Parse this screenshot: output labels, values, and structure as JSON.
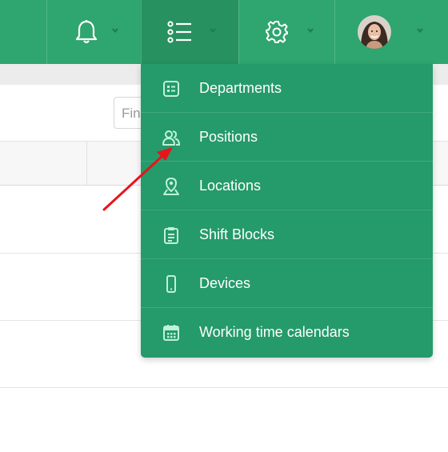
{
  "topbar": {
    "background": "#2fa56f",
    "items": [
      {
        "name": "notifications",
        "icon": "bell-icon"
      },
      {
        "name": "lists",
        "icon": "list-icon",
        "active": true
      },
      {
        "name": "settings",
        "icon": "gear-icon"
      },
      {
        "name": "profile",
        "icon": "avatar"
      }
    ]
  },
  "search": {
    "placeholder": "Find"
  },
  "dropdown": {
    "background": "#259a6a",
    "items": [
      {
        "label": "Departments",
        "icon": "department-list-icon"
      },
      {
        "label": "Positions",
        "icon": "people-icon"
      },
      {
        "label": "Locations",
        "icon": "location-pin-icon"
      },
      {
        "label": "Shift Blocks",
        "icon": "clipboard-icon"
      },
      {
        "label": "Devices",
        "icon": "mobile-device-icon"
      },
      {
        "label": "Working time calendars",
        "icon": "calendar-icon"
      }
    ]
  },
  "annotation": {
    "color": "#e8141b",
    "icon": "red-arrow-pointer"
  }
}
